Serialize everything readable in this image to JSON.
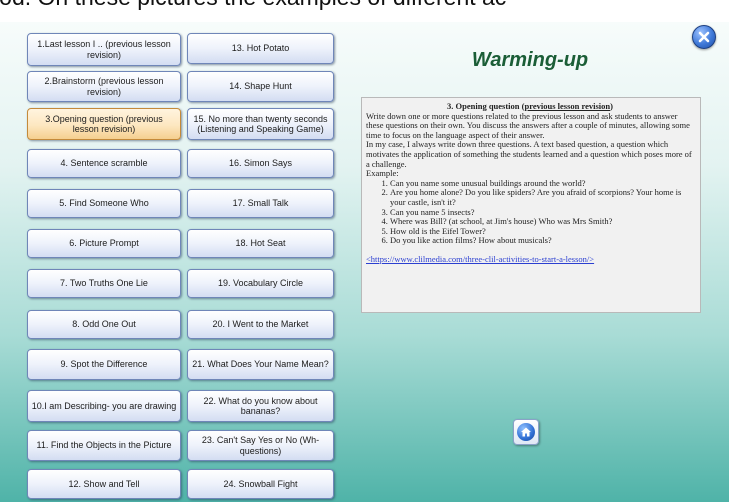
{
  "header_text": "rkod. On these pictures the examples of different ac",
  "title": "Warming-up",
  "buttons_left": [
    "1.Last lesson I .. (previous lesson revision)",
    "2.Brainstorm (previous lesson revision)",
    "3.Opening question (previous lesson revision)",
    "4. Sentence scramble",
    "5. Find Someone Who",
    "6. Picture Prompt",
    "7. Two Truths One Lie",
    "8. Odd One Out",
    "9. Spot the Difference",
    "10.I am  Describing-  you are drawing",
    "11. Find the Objects in the Picture",
    "12. Show and Tell"
  ],
  "buttons_right": [
    "13. Hot Potato",
    "14. Shape Hunt",
    "15. No more than twenty seconds (Listening and Speaking Game)",
    "16. Simon Says",
    "17. Small Talk",
    "18. Hot Seat",
    "19. Vocabulary Circle",
    "20. I Went to the Market",
    "21. What Does Your Name Mean?",
    "22. What do you know about bananas?",
    "23. Can't Say Yes or No  (Wh-questions)",
    "24. Snowball Fight"
  ],
  "active_button": "3.Opening question (previous lesson revision)",
  "content": {
    "heading_prefix": "3.  Opening question (",
    "heading_link": "previous lesson revision",
    "heading_suffix": ")",
    "paragraph1": "Write down one or more questions related to the previous lesson and ask students to answer these questions on their own. You discuss the answers after a couple of minutes, allowing some time to focus on the language aspect of their answer.",
    "paragraph2": "In my case, I always write down three questions. A text based question, a question which motivates the application of something the students learned and a question which poses more of a challenge.",
    "example_label": "Example:",
    "examples": [
      "Can you name some unusual buildings around the world?",
      "Are you home alone? Do you like spiders? Are you afraid of scorpions? Your home is your castle, isn't it?",
      "Can you name 5 insects?",
      "Where was Bill? (at school, at Jim's house) Who was Mrs Smith?",
      "How old is the Eifel Tower?",
      "Do you like action films? How about musicals?"
    ],
    "link": "<https://www.clilmedia.com/three-clil-activities-to-start-a-lesson/>"
  },
  "icons": {
    "close": "close-x-icon",
    "home": "home-icon"
  },
  "colors": {
    "title": "#1b5e37",
    "button_border": "#6f86b8",
    "active_button": "#fde7c0",
    "background_bottom": "#4fb3a8",
    "link": "#2b3fd1"
  }
}
